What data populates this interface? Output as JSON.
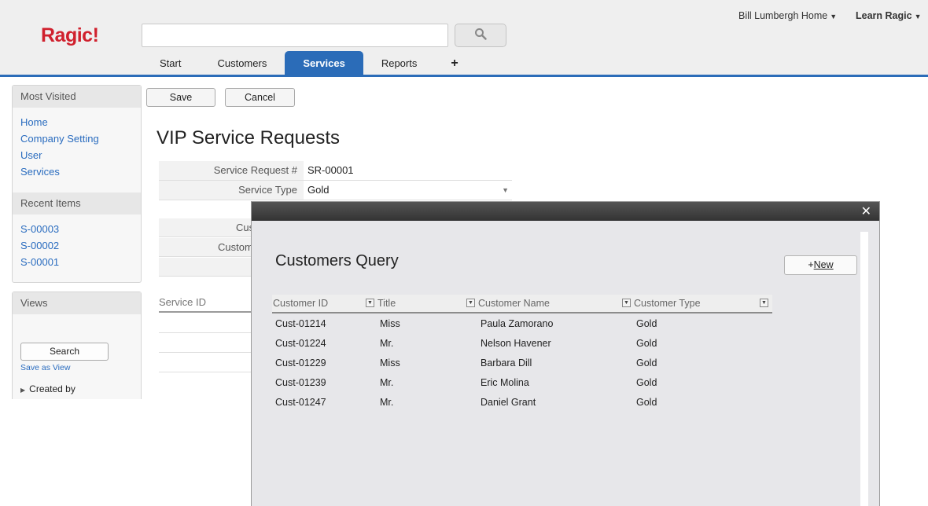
{
  "header": {
    "logo": "Ragic!",
    "search_placeholder": "",
    "user_home": "Bill Lumbergh Home",
    "learn": "Learn Ragic",
    "tabs": [
      {
        "label": "Start"
      },
      {
        "label": "Customers"
      },
      {
        "label": "Services"
      },
      {
        "label": "Reports"
      },
      {
        "label": "+"
      }
    ],
    "active_tab": "Services",
    "accent_color": "#2b6cb8",
    "logo_color": "#d0202d"
  },
  "sidebar": {
    "most_visited_title": "Most Visited",
    "most_visited": [
      {
        "label": "Home"
      },
      {
        "label": "Company Setting"
      },
      {
        "label": "User"
      },
      {
        "label": "Services"
      }
    ],
    "recent_title": "Recent Items",
    "recent": [
      {
        "label": "S-00003"
      },
      {
        "label": "S-00002"
      },
      {
        "label": "S-00001"
      }
    ],
    "views_title": "Views",
    "search_label": "Search",
    "save_as_view": "Save as View",
    "created_by": "Created by"
  },
  "form": {
    "save_label": "Save",
    "cancel_label": "Cancel",
    "title": "VIP Service Requests",
    "fields": [
      {
        "label": "Service Request #",
        "value": "SR-00001"
      },
      {
        "label": "Service Type",
        "value": "Gold"
      }
    ],
    "partial_labels": [
      "Cus",
      "Custom"
    ],
    "subtable_header": "Service ID"
  },
  "modal": {
    "close": "✕",
    "title": "Customers Query",
    "new_label_prefix": "+",
    "new_label_main": "New",
    "columns": [
      "Customer ID",
      "Title",
      "Customer Name",
      "Customer Type"
    ],
    "rows": [
      [
        "Cust-01214",
        "Miss",
        "Paula Zamorano",
        "Gold"
      ],
      [
        "Cust-01224",
        "Mr.",
        "Nelson Havener",
        "Gold"
      ],
      [
        "Cust-01229",
        "Miss",
        "Barbara Dill",
        "Gold"
      ],
      [
        "Cust-01239",
        "Mr.",
        "Eric Molina",
        "Gold"
      ],
      [
        "Cust-01247",
        "Mr.",
        "Daniel Grant",
        "Gold"
      ]
    ]
  }
}
